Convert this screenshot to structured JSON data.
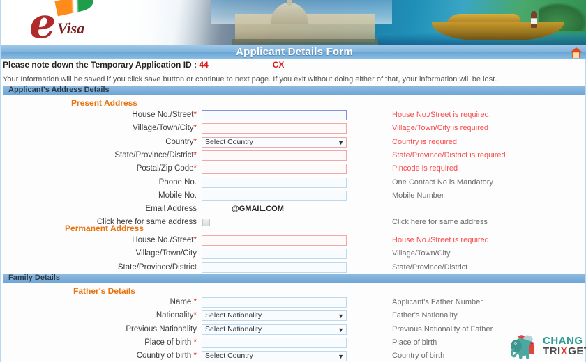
{
  "brand": {
    "logo_e": "e",
    "logo_visa": "Visa",
    "logo_name": "evisa-logo"
  },
  "header": {
    "title": "Applicant Details Form",
    "home_icon": "home-icon"
  },
  "notice": {
    "label": "Please note down the Temporary Application ID : ",
    "application_id": "44",
    "application_id_tail": "CX",
    "save_info": "Your Information will be saved if you click save button or continue to next page. If you exit without doing either of that, your information will be lost."
  },
  "sections": [
    {
      "id": "address",
      "title": "Applicant's Address Details"
    },
    {
      "id": "family",
      "title": "Family Details"
    }
  ],
  "groups": {
    "present_address": "Present Address",
    "permanent_address": "Permanent Address",
    "fathers_details": "Father's Details"
  },
  "present_address_fields": [
    {
      "label": "House No./Street",
      "required": true,
      "type": "text",
      "value": "",
      "state": "focus",
      "hint": "House No./Street is required.",
      "hint_red": true
    },
    {
      "label": "Village/Town/City",
      "required": true,
      "type": "text",
      "value": "",
      "state": "err",
      "hint": "Village/Town/City is required",
      "hint_red": true
    },
    {
      "label": "Country",
      "required": true,
      "type": "select",
      "value": "Select Country",
      "state": "err",
      "hint": "Country is required",
      "hint_red": true
    },
    {
      "label": "State/Province/District",
      "required": true,
      "type": "text",
      "value": "",
      "state": "err",
      "hint": "State/Province/District is required",
      "hint_red": true
    },
    {
      "label": "Postal/Zip Code",
      "required": true,
      "type": "text",
      "value": "",
      "state": "err",
      "hint": "Pincode is required",
      "hint_red": true
    },
    {
      "label": "Phone No.",
      "required": false,
      "type": "text",
      "value": "",
      "state": "",
      "hint": "One Contact No is Mandatory",
      "hint_red": false
    },
    {
      "label": "Mobile No.",
      "required": false,
      "type": "text",
      "value": "",
      "state": "",
      "hint": "Mobile Number",
      "hint_red": false
    },
    {
      "label": "Email Address",
      "required": false,
      "type": "static",
      "value": "@GMAIL.COM",
      "state": "",
      "hint": "",
      "hint_red": false
    },
    {
      "label": "Click here for same address",
      "required": false,
      "type": "checkbox",
      "value": "",
      "state": "",
      "hint": "Click here for same address",
      "hint_red": false
    }
  ],
  "permanent_address_fields": [
    {
      "label": "House No./Street",
      "required": true,
      "type": "text",
      "value": "",
      "state": "err",
      "hint": "House No./Street is required.",
      "hint_red": true
    },
    {
      "label": "Village/Town/City",
      "required": false,
      "type": "text",
      "value": "",
      "state": "",
      "hint": "Village/Town/City",
      "hint_red": false
    },
    {
      "label": "State/Province/District",
      "required": false,
      "type": "text",
      "value": "",
      "state": "",
      "hint": "State/Province/District",
      "hint_red": false
    }
  ],
  "father_fields": [
    {
      "label": "Name ",
      "required": true,
      "type": "text",
      "value": "",
      "state": "",
      "hint": "Applicant's Father Number",
      "hint_red": false
    },
    {
      "label": "Nationality",
      "required": true,
      "type": "select",
      "value": "Select Nationality",
      "state": "",
      "hint": "Father's Nationality",
      "hint_red": false
    },
    {
      "label": "Previous Nationality",
      "required": false,
      "type": "select",
      "value": "Select Nationality",
      "state": "",
      "hint": "Previous Nationality of Father",
      "hint_red": false
    },
    {
      "label": "Place of birth ",
      "required": true,
      "type": "text",
      "value": "",
      "state": "",
      "hint": "Place of birth",
      "hint_red": false
    },
    {
      "label": "Country of birth ",
      "required": true,
      "type": "select",
      "value": "Select Country",
      "state": "",
      "hint": "Country of birth",
      "hint_red": false
    }
  ],
  "watermark": {
    "part1": "CHANG",
    "part2_a": "TRI",
    "part2_x": "X",
    "part2_b": "GET",
    "icon": "elephant-icon"
  },
  "colors": {
    "title_bar": "#7fb3dd",
    "section_bar": "#6fa6d4",
    "group_title": "#e8720c",
    "error_text": "#fb4b4b",
    "id_red": "#e01b1b",
    "watermark_teal": "#2e9c93"
  }
}
